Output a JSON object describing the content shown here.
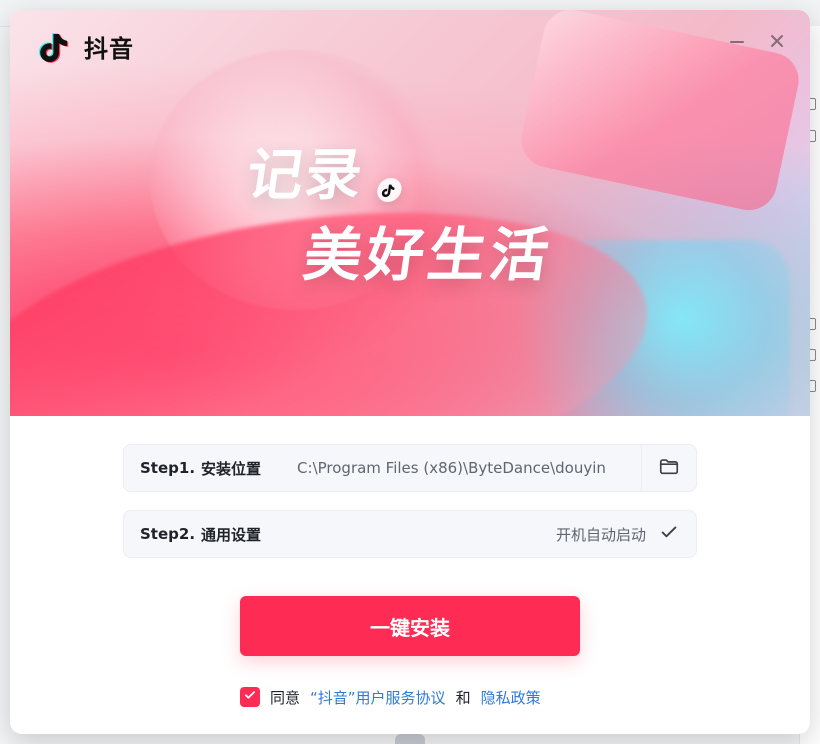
{
  "app": {
    "brand_name": "抖音",
    "brand_icon": "douyin-logo",
    "colors": {
      "accent": "#fe2c55",
      "link": "#2f7bd7",
      "step_bg": "#f6f7fa",
      "text_primary": "#1f2329",
      "text_secondary": "#5f6670"
    }
  },
  "window": {
    "minimize_icon": "minimize-icon",
    "close_icon": "close-icon"
  },
  "hero": {
    "slogan_line1": "记录",
    "slogan_line2": "美好生活",
    "slogan_badge_icon": "douyin-mini-badge"
  },
  "steps": [
    {
      "title": "Step1.",
      "label": "安装位置",
      "value": "C:\\Program Files (x86)\\ByteDance\\douyin",
      "action_icon": "folder-icon"
    },
    {
      "title": "Step2.",
      "label": "通用设置",
      "value": "开机自动启动",
      "action_icon": "check-icon"
    }
  ],
  "primary_action": {
    "label": "一键安装"
  },
  "agreement": {
    "checked": true,
    "prefix": "同意",
    "terms_link": "“抖音”用户服务协议",
    "and": "和",
    "privacy_link": "隐私政策"
  }
}
